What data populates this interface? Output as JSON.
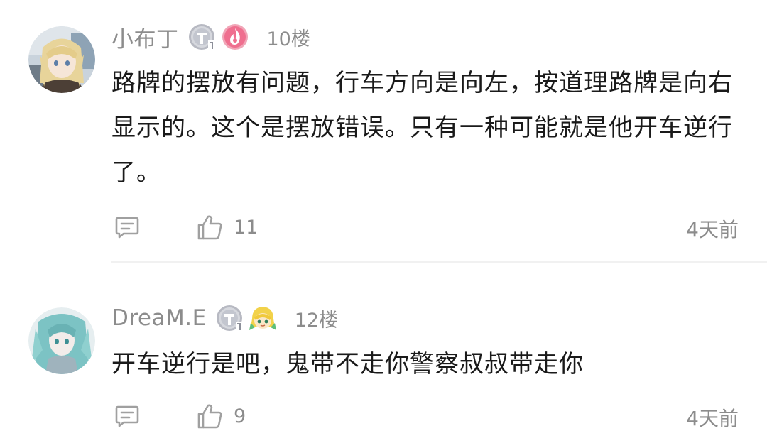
{
  "comments": [
    {
      "username": "小布丁",
      "floor": "10楼",
      "content": "路牌的摆放有问题，行车方向是向左，按道理路牌是向右显示的。这个是摆放错误。只有一种可能就是他开车逆行了。",
      "like_count": "11",
      "time": "4天前",
      "level_badge_icon": "level-t1-badge-icon",
      "fan_badge_icon": "pink-flame-badge-icon"
    },
    {
      "username": "DreaM.E",
      "floor": "12楼",
      "content": "开车逆行是吧，鬼带不走你警察叔叔带走你",
      "like_count": "9",
      "time": "4天前",
      "level_badge_icon": "level-t1-badge-icon",
      "fan_badge_icon": "blonde-character-badge-icon"
    }
  ],
  "colors": {
    "meta_text": "#8c8c8c",
    "body_text": "#1a1a1a",
    "icon_gray": "#a0a0a0",
    "divider": "#f1f1f1",
    "fan_badge_pink": "#ef6f8f"
  }
}
